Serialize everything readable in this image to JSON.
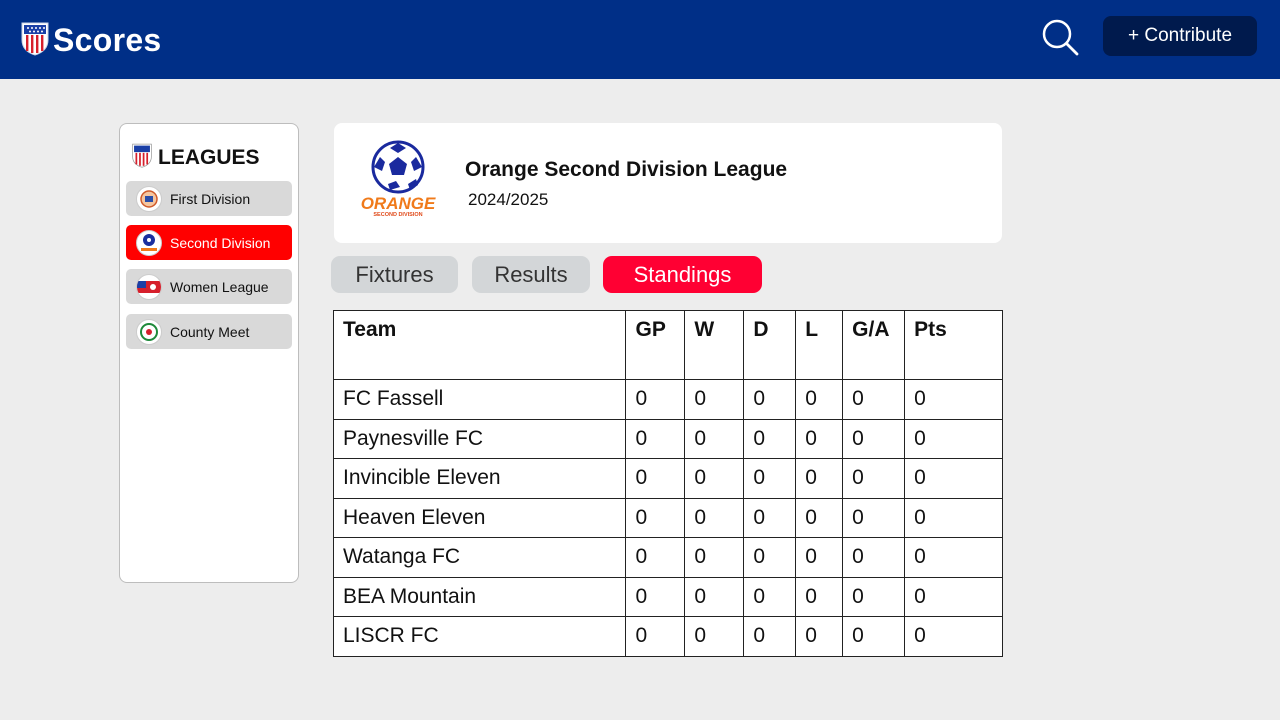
{
  "header": {
    "title": "Scores",
    "contribute_label": "+ Contribute",
    "icons": {
      "logo": "shield-flag-icon",
      "search": "search-icon"
    },
    "colors": {
      "bar": "#002f87",
      "button": "#001a4d"
    }
  },
  "sidebar": {
    "title": "LEAGUES",
    "items": [
      {
        "label": "First Division",
        "icon": "first-division-logo-icon",
        "active": false
      },
      {
        "label": "Second Division",
        "icon": "second-division-logo-icon",
        "active": true
      },
      {
        "label": "Women League",
        "icon": "women-league-logo-icon",
        "active": false
      },
      {
        "label": "County Meet",
        "icon": "county-meet-logo-icon",
        "active": false
      }
    ]
  },
  "league": {
    "name": "Orange Second Division League",
    "season": "2024/2025",
    "logo": {
      "wordmark": "ORANGE",
      "subtext": "SECOND DIVISION"
    }
  },
  "tabs": [
    {
      "label": "Fixtures",
      "active": false
    },
    {
      "label": "Results",
      "active": false
    },
    {
      "label": "Standings",
      "active": true
    }
  ],
  "standings": {
    "columns": [
      "Team",
      "GP",
      "W",
      "D",
      "L",
      "G/A",
      "Pts"
    ],
    "rows": [
      [
        "FC Fassell",
        "0",
        "0",
        "0",
        "0",
        "0",
        "0"
      ],
      [
        "Paynesville FC",
        "0",
        "0",
        "0",
        "0",
        "0",
        "0"
      ],
      [
        "Invincible Eleven",
        "0",
        "0",
        "0",
        "0",
        "0",
        "0"
      ],
      [
        "Heaven Eleven",
        "0",
        "0",
        "0",
        "0",
        "0",
        "0"
      ],
      [
        "Watanga FC",
        "0",
        "0",
        "0",
        "0",
        "0",
        "0"
      ],
      [
        "BEA Mountain",
        "0",
        "0",
        "0",
        "0",
        "0",
        "0"
      ],
      [
        "LISCR FC",
        "0",
        "0",
        "0",
        "0",
        "0",
        "0"
      ]
    ]
  },
  "colors": {
    "active_tab": "#ff0033",
    "active_league": "#ff0000"
  }
}
